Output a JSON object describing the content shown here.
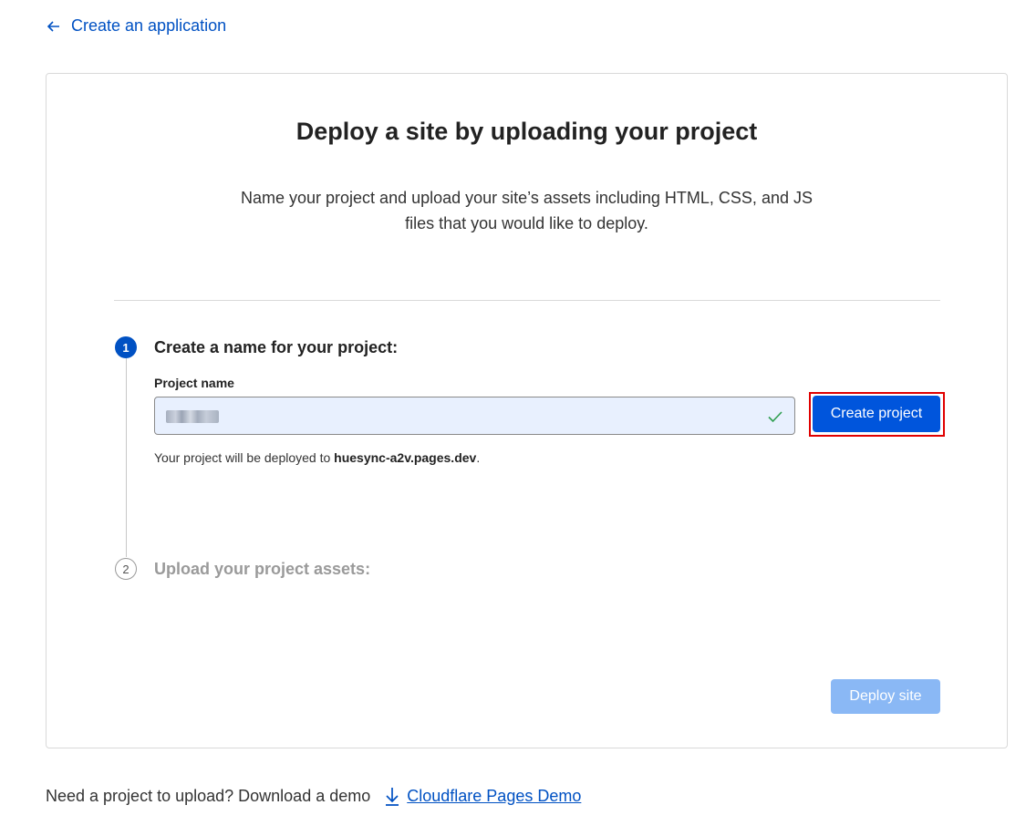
{
  "nav": {
    "back_label": "Create an application",
    "back_icon": "arrow-left-icon"
  },
  "card": {
    "title": "Deploy a site by uploading your project",
    "description": "Name your project and upload your site’s assets including HTML, CSS, and JS files that you would like to deploy."
  },
  "steps": [
    {
      "number": "1",
      "title": "Create a name for your project:",
      "state": "active"
    },
    {
      "number": "2",
      "title": "Upload your project assets:",
      "state": "inactive"
    }
  ],
  "project_form": {
    "label": "Project name",
    "value": "",
    "value_obscured": true,
    "valid_icon": "check-icon",
    "create_button": "Create project",
    "deploy_note_prefix": "Your project will be deployed to ",
    "deploy_domain": "huesync-a2v.pages.dev",
    "deploy_note_suffix": "."
  },
  "actions": {
    "deploy_button": "Deploy site",
    "deploy_enabled": false
  },
  "footer": {
    "text": "Need a project to upload? Download a demo",
    "link_label": "Cloudflare Pages Demo",
    "link_icon": "download-icon"
  },
  "colors": {
    "accent": "#0051c3",
    "button_primary": "#0055dc",
    "button_disabled": "#8ab8f5",
    "highlight": "#e00000",
    "success": "#2e9e4f"
  }
}
